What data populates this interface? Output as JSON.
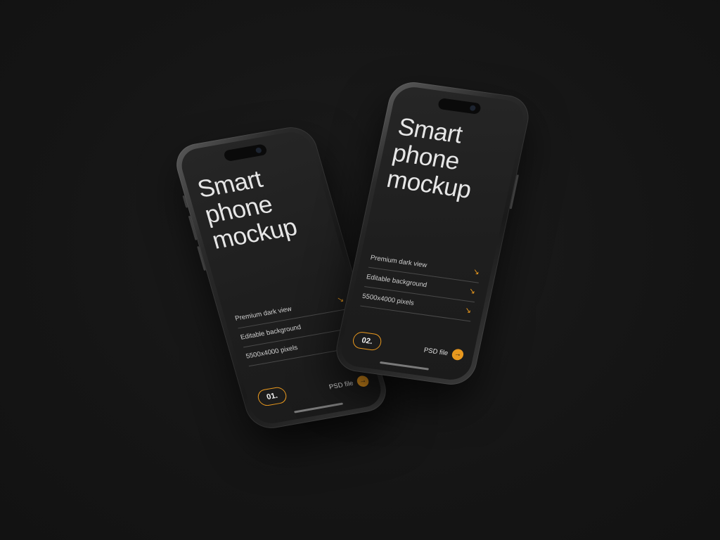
{
  "colors": {
    "background": "#161616",
    "accent": "#e8981e",
    "headline_text": "#e6e6e6"
  },
  "phones": [
    {
      "headline": [
        "Smart",
        "phone",
        "mockup"
      ],
      "features": [
        {
          "label": "Premium dark view",
          "icon": "arrow-down-right-icon"
        },
        {
          "label": "Editable background",
          "icon": "arrow-down-right-icon"
        },
        {
          "label": "5500x4000 pixels",
          "icon": "arrow-down-right-icon"
        }
      ],
      "number": "01.",
      "file_label": "PSD file",
      "file_icon": "arrow-right-icon"
    },
    {
      "headline": [
        "Smart",
        "phone",
        "mockup"
      ],
      "features": [
        {
          "label": "Premium dark view",
          "icon": "arrow-down-right-icon"
        },
        {
          "label": "Editable background",
          "icon": "arrow-down-right-icon"
        },
        {
          "label": "5500x4000 pixels",
          "icon": "arrow-down-right-icon"
        }
      ],
      "number": "02.",
      "file_label": "PSD file",
      "file_icon": "arrow-right-icon"
    }
  ]
}
